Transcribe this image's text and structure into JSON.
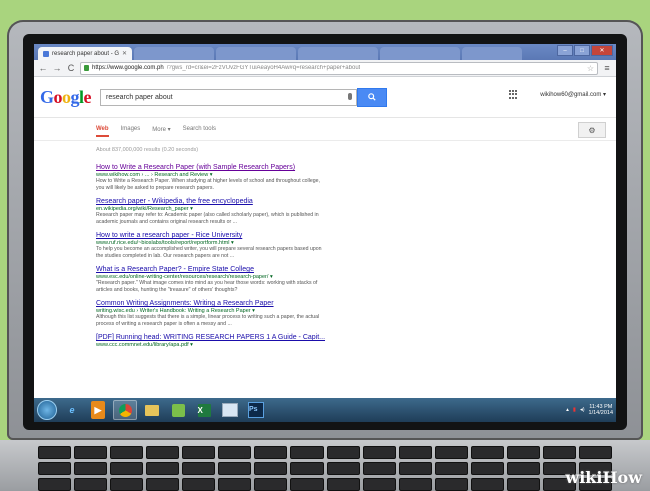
{
  "browser": {
    "active_tab": "research paper about - G",
    "background_tabs": [
      "",
      "",
      "",
      "",
      "",
      ""
    ],
    "url_host": "https://www.google.com.ph",
    "url_rest": "/?gws_rd=cr&ei=2FzVUvzFGYTuiAeayoH4Aw#q=research+paper+about",
    "win_min": "–",
    "win_max": "□",
    "win_close": "✕"
  },
  "google": {
    "logo": [
      "G",
      "o",
      "o",
      "g",
      "l",
      "e"
    ],
    "logo_colors": [
      "#3369e8",
      "#d50f25",
      "#eeb211",
      "#3369e8",
      "#009925",
      "#d50f25"
    ],
    "query": "research paper about",
    "account": "wikihow60@gmail.com ▾",
    "tabs": [
      "Web",
      "Images",
      "More ▾",
      "Search tools"
    ],
    "stats": "About 837,000,000 results (0.20 seconds)"
  },
  "results": [
    {
      "title": "How to Write a Research Paper (with Sample Research Papers)",
      "url": "www.wikihow.com › ... › Research and Review ▾",
      "snippet": "How to Write a Research Paper. When studying at higher levels of school and throughout college, you will likely be asked to prepare research papers."
    },
    {
      "title": "Research paper - Wikipedia, the free encyclopedia",
      "url": "en.wikipedia.org/wiki/Research_paper ▾",
      "snippet": "Research paper may refer to: Academic paper (also called scholarly paper), which is published in academic journals and contains original research results or ..."
    },
    {
      "title": "How to write a research paper - Rice University",
      "url": "www.ruf.rice.edu/~bioslabs/tools/report/reportform.html ▾",
      "snippet": "To help you become an accomplished writer, you will prepare several research papers based upon the studies completed in lab. Our research papers are not ..."
    },
    {
      "title": "What is a Research Paper? - Empire State College",
      "url": "www.esc.edu/online-writing-center/resources/research/research-paper/ ▾",
      "snippet": "\"Research paper.\" What image comes into mind as you hear those words: working with stacks of articles and books, hunting the \"treasure\" of others' thoughts?"
    },
    {
      "title": "Common Writing Assignments: Writing a Research Paper",
      "url": "writing.wisc.edu › Writer's Handbook: Writing a Research Paper ▾",
      "snippet": "Although this list suggests that there is a simple, linear process to writing such a paper, the actual process of writing a research paper is often a messy and ..."
    },
    {
      "title": "[PDF] Running head: WRITING RESEARCH PAPERS 1 A Guide - Capit...",
      "url": "www.ccc.commnet.edu/library/apa.pdf ▾",
      "snippet": ""
    }
  ],
  "taskbar": {
    "icons": [
      "ie-icon",
      "media-player-icon",
      "chrome-icon",
      "folder-icon",
      "winamp-icon",
      "excel-icon",
      "explorer-icon",
      "photoshop-icon"
    ],
    "time": "11:43 PM",
    "date": "1/14/2014"
  },
  "watermark": "wikiHow"
}
